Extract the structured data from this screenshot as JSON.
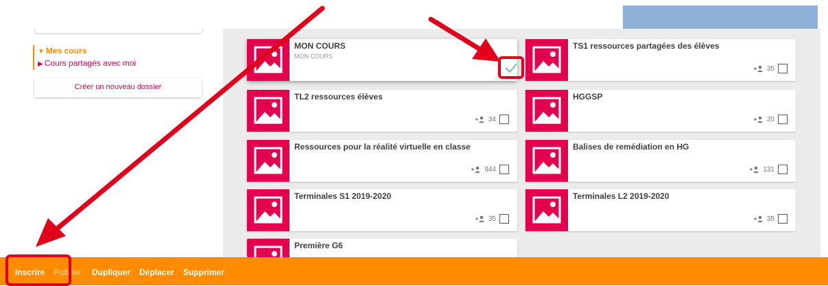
{
  "sidebar": {
    "tree": {
      "mine": "Mes cours",
      "shared": "Cours partagés avec moi"
    },
    "new_folder": "Créer un nouveau dossier"
  },
  "courses": [
    {
      "title": "MON COURS",
      "subtitle": "MON COURS",
      "count": "",
      "selected": true
    },
    {
      "title": "TS1 ressources partagées des élèves",
      "subtitle": "",
      "count": "35",
      "selected": false
    },
    {
      "title": "TL2 ressources élèves",
      "subtitle": "",
      "count": "34",
      "selected": false
    },
    {
      "title": "HGGSP",
      "subtitle": "",
      "count": "20",
      "selected": false
    },
    {
      "title": "Ressources pour la réalité virtuelle en classe",
      "subtitle": "",
      "count": "944",
      "selected": false
    },
    {
      "title": "Balises de remédiation en HG",
      "subtitle": "",
      "count": "131",
      "selected": false
    },
    {
      "title": "Terminales S1 2019-2020",
      "subtitle": "",
      "count": "35",
      "selected": false
    },
    {
      "title": "Terminales L2 2019-2020",
      "subtitle": "",
      "count": "35",
      "selected": false
    },
    {
      "title": "Première G6",
      "subtitle": "",
      "count": "",
      "selected": false
    }
  ],
  "actions": {
    "inscrire": "Inscrire",
    "publier": "Publier",
    "dupliquer": "Dupliquer",
    "deplacer": "Déplacer",
    "supprimer": "Supprimer"
  },
  "colors": {
    "accent_orange": "#ff8c00",
    "thumb_red": "#e2004f",
    "annotation_red": "#e0001a",
    "check_green": "#4db6a0"
  },
  "icons": {
    "course_thumb": "image-placeholder-icon",
    "members": "person-add-icon",
    "selected": "checkmark-icon"
  }
}
